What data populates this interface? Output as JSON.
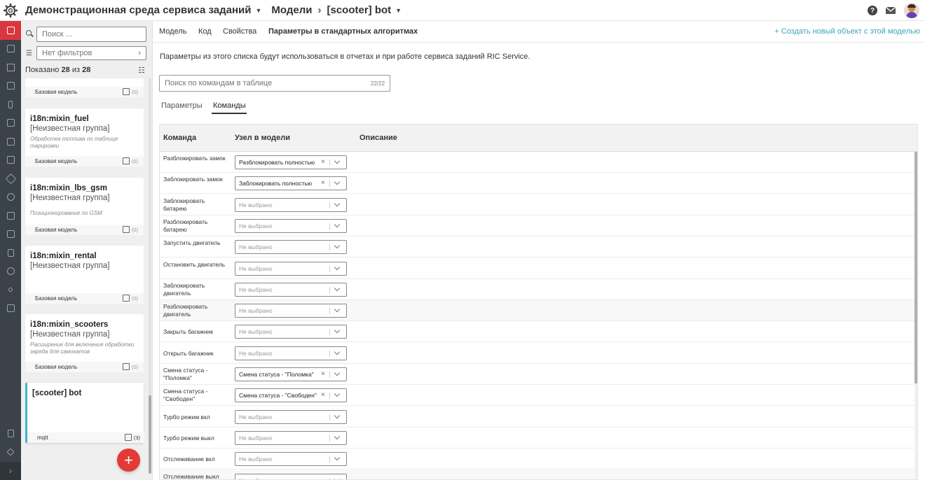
{
  "header": {
    "environment": "Демонстрационная среда сервиса заданий",
    "section": "Модели",
    "current": "[scooter] bot"
  },
  "sidebar": {
    "search_placeholder": "Поиск ...",
    "filter_value": "Нет фильтров",
    "shown_prefix": "Показано",
    "shown_count": "28",
    "shown_of": "из",
    "shown_total": "28",
    "cards": [
      {
        "title": "",
        "group": "",
        "description": "",
        "footer": "Базовая модель",
        "count": "(0)"
      },
      {
        "title": "i18n:mixin_fuel",
        "group": "[Неизвестная группа]",
        "description": "Обработка топлива по таблице тарировки",
        "footer": "Базовая модель",
        "count": "(0)"
      },
      {
        "title": "i18n:mixin_lbs_gsm",
        "group": "[Неизвестная группа]",
        "description": "Позиционирование по GSM",
        "footer": "Базовая модель",
        "count": "(0)"
      },
      {
        "title": "i18n:mixin_rental",
        "group": "[Неизвестная группа]",
        "description": "",
        "footer": "Базовая модель",
        "count": "(0)"
      },
      {
        "title": "i18n:mixin_scooters",
        "group": "[Неизвестная группа]",
        "description": "Расширение для включения обработки заряда для самокатов",
        "footer": "Базовая модель",
        "count": "(0)"
      },
      {
        "title": "[scooter] bot",
        "group": "",
        "description": "",
        "footer": "mqtt",
        "count": "(3)"
      }
    ]
  },
  "main": {
    "tabs": [
      "Модель",
      "Код",
      "Свойства",
      "Параметры в стандартных алгоритмах"
    ],
    "active_tab": "Параметры в стандартных алгоритмах",
    "create_link": "+ Создать новый объект с этой моделью",
    "info": "Параметры из этого списка будут использоваться в отчетах и при работе сервиса заданий RIC Service.",
    "search_placeholder": "Поиск по командам в таблице",
    "search_count": "22/22",
    "subtabs": [
      "Параметры",
      "Команды"
    ],
    "table": {
      "headers": [
        "Команда",
        "Узел в модели",
        "Описание"
      ],
      "placeholder": "Не выбрано",
      "rows": [
        {
          "name": "Разблокировать замок",
          "value": "Разблокировать полностью"
        },
        {
          "name": "Заблокировать замок",
          "value": "Заблокировать полностью"
        },
        {
          "name": "Заблокировать батарею",
          "value": ""
        },
        {
          "name": "Разблокировать батарею",
          "value": ""
        },
        {
          "name": "Запустить двигатель",
          "value": ""
        },
        {
          "name": "Остановить двигатель",
          "value": ""
        },
        {
          "name": "Заблокировать двигатель",
          "value": ""
        },
        {
          "name": "Разблокировать двигатель",
          "value": ""
        },
        {
          "name": "Закрыть багажник",
          "value": ""
        },
        {
          "name": "Открыть багажник",
          "value": ""
        },
        {
          "name": "Смена статуса - \"Поломка\"",
          "value": "Смена статуса - \"Поломка\""
        },
        {
          "name": "Смена статуса - \"Свободен\"",
          "value": "Смена статуса - \"Свободен\""
        },
        {
          "name": "Турбо режим вкл",
          "value": ""
        },
        {
          "name": "Турбо режим выкл",
          "value": ""
        },
        {
          "name": "Отслеживание вкл",
          "value": ""
        },
        {
          "name": "Отслеживание выкл",
          "value": ""
        }
      ]
    }
  },
  "colors": {
    "accent": "#3ab6c9",
    "danger": "#e53935",
    "rail": "#3b4249",
    "rail_active": "#d9363e"
  }
}
